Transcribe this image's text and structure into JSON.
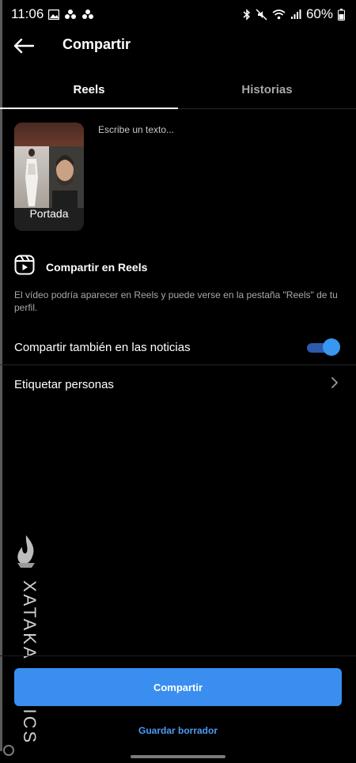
{
  "status_bar": {
    "time": "11:06",
    "battery": "60%",
    "icons_left": [
      "gallery-icon",
      "dots-icon",
      "dots-icon"
    ],
    "icons_right": [
      "bluetooth-icon",
      "mute-icon",
      "wifi-icon",
      "signal-icon",
      "battery-icon"
    ]
  },
  "header": {
    "title": "Compartir",
    "back_icon": "arrow-left-icon"
  },
  "tabs": [
    {
      "label": "Reels",
      "active": true
    },
    {
      "label": "Historias",
      "active": false
    }
  ],
  "cover": {
    "label": "Portada"
  },
  "caption": {
    "placeholder": "Escribe un texto..."
  },
  "reels_section": {
    "title": "Compartir en Reels",
    "icon": "reels-icon",
    "description": "El vídeo podría aparecer en Reels y puede verse en la pestaña \"Reels\" de tu perfil."
  },
  "share_feed": {
    "label": "Compartir también en las noticias",
    "enabled": true
  },
  "tag_people": {
    "label": "Etiquetar personas",
    "icon": "chevron-right-icon"
  },
  "watermark": {
    "text": "XATAKA BASICS"
  },
  "actions": {
    "share_label": "Compartir",
    "draft_label": "Guardar borrador"
  },
  "colors": {
    "accent": "#3a8eef",
    "link": "#4c9bf5",
    "background": "#000000"
  }
}
